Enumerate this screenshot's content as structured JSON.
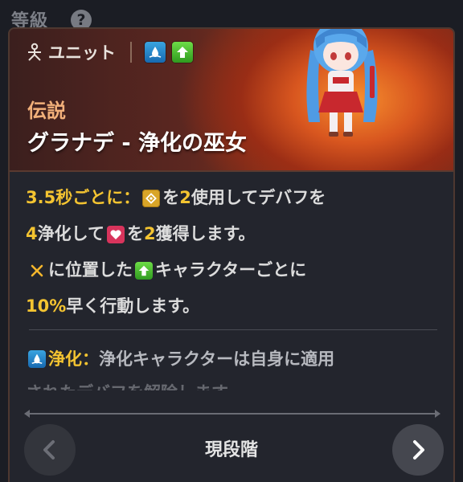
{
  "header": {
    "section_title": "等級",
    "help_icon": "?"
  },
  "card": {
    "category_label": "ユニット",
    "category_icon": "unit-icon",
    "badges": [
      "water-drop-icon",
      "upgrade-arrow-icon"
    ],
    "rarity": "伝説",
    "name": "グラナデ - 浄化の巫女"
  },
  "description": {
    "line1": {
      "prefix": "3.5秒ごとに：",
      "t1": "を",
      "n1": "2",
      "t2": "使用してデバフを"
    },
    "line2": {
      "n1": "4",
      "t1": "浄化して",
      "t2": "を",
      "n2": "2",
      "t3": "獲得します。"
    },
    "line3": {
      "t1": "に位置した",
      "t2": "キャラクターごとに"
    },
    "line4": {
      "n1": "10%",
      "t1": "早く行動します。"
    }
  },
  "skill": {
    "keyword": "浄化",
    "colon": "：",
    "line1": "浄化キャラクターは自身に適用",
    "line2": "されたデバフを解除します。"
  },
  "footer": {
    "stage_label": "現段階",
    "prev_icon": "chevron-left-icon",
    "next_icon": "chevron-right-icon"
  },
  "colors": {
    "accent_yellow": "#f4c431",
    "rarity_orange": "#f2b07a",
    "water_blue": "#2a8fd4",
    "upgrade_green": "#4cbf30",
    "heart_pink": "#d8345c"
  }
}
